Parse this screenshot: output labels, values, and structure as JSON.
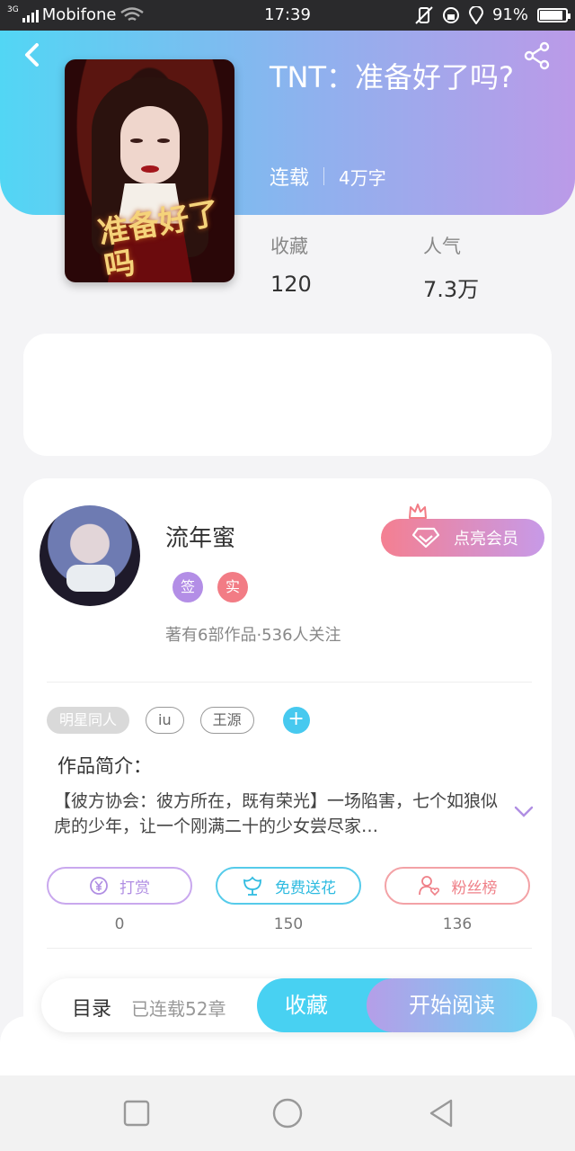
{
  "status_bar": {
    "network": "3G",
    "carrier": "Mobifone",
    "time": "17:39",
    "battery": "91%",
    "battery_level": 0.91
  },
  "book": {
    "title": "TNT：准备好了吗?",
    "status": "连载",
    "words": "4万字",
    "cover_title": "准备好了吗"
  },
  "stats": {
    "favorites_label": "收藏",
    "favorites_value": "120",
    "popularity_label": "人气",
    "popularity_value": "7.3万"
  },
  "author": {
    "name": "流年蜜",
    "badge_signed": "签",
    "badge_verified": "实",
    "info": "著有6部作品·536人关注",
    "vip_button": "点亮会员"
  },
  "tags": [
    "明星同人",
    "iu",
    "王源"
  ],
  "intro": {
    "title": "作品简介：",
    "text": "【彼方协会：彼方所在，既有荣光】一场陷害，七个如狼似虎的少年，让一个刚满二十的少女尝尽家…"
  },
  "actions": {
    "tip_label": "打赏",
    "tip_count": "0",
    "flower_label": "免费送花",
    "flower_count": "150",
    "fans_label": "粉丝榜",
    "fans_count": "136"
  },
  "bottom_bar": {
    "toc": "目录",
    "chapters": "已连载52章",
    "favorite": "收藏",
    "read": "开始阅读"
  },
  "icons": {
    "back": "chevron-left-icon",
    "share": "share-icon",
    "crown": "crown-icon",
    "diamond": "diamond-icon",
    "yen": "yen-icon",
    "flower": "flower-icon",
    "fans": "user-heart-icon",
    "expand": "chevron-down-icon"
  },
  "colors": {
    "accent_cyan": "#48d1f2",
    "accent_purple": "#b59ee8",
    "accent_pink": "#f27c85"
  }
}
